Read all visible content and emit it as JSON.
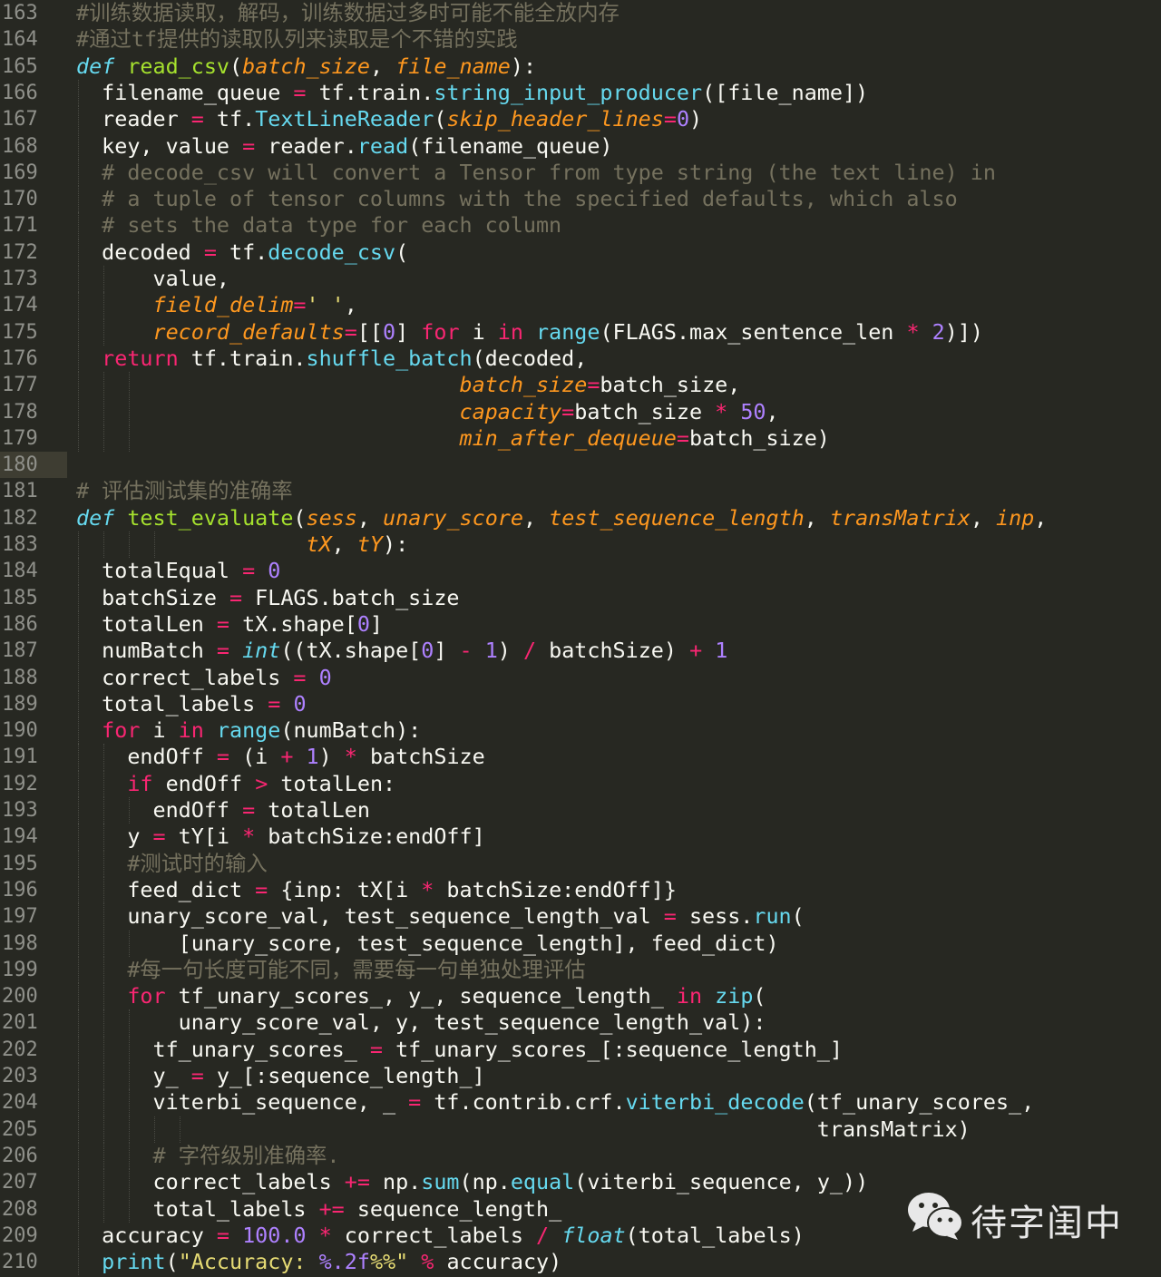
{
  "watermark": {
    "text": "待字闺中",
    "icon": "wechat-icon"
  },
  "highlight_line": 180,
  "colors": {
    "background": "#272822",
    "gutter_text": "#8f908a",
    "comment": "#75715e",
    "keyword": "#f92672",
    "function": "#a6e22e",
    "parameter": "#fd971f",
    "builtin": "#66d9ef",
    "number": "#ae81ff",
    "string": "#e6db74"
  },
  "lines": [
    {
      "n": "163",
      "i": 0,
      "t": [
        [
          "cm",
          "#训练数据读取，解码，训练数据过多时可能不能全放内存"
        ]
      ]
    },
    {
      "n": "164",
      "i": 0,
      "t": [
        [
          "cm",
          "#通过tf提供的读取队列来读取是个不错的实践"
        ]
      ]
    },
    {
      "n": "165",
      "i": 0,
      "t": [
        [
          "st",
          "def"
        ],
        [
          "df",
          " "
        ],
        [
          "fn",
          "read_csv"
        ],
        [
          "df",
          "("
        ],
        [
          "pa",
          "batch_size"
        ],
        [
          "df",
          ", "
        ],
        [
          "pa",
          "file_name"
        ],
        [
          "df",
          "):"
        ]
      ]
    },
    {
      "n": "166",
      "i": 1,
      "t": [
        [
          "df",
          "  filename_queue "
        ],
        [
          "op",
          "="
        ],
        [
          "df",
          " tf.train."
        ],
        [
          "bi",
          "string_input_producer"
        ],
        [
          "df",
          "([file_name])"
        ]
      ]
    },
    {
      "n": "167",
      "i": 1,
      "t": [
        [
          "df",
          "  reader "
        ],
        [
          "op",
          "="
        ],
        [
          "df",
          " tf."
        ],
        [
          "bi",
          "TextLineReader"
        ],
        [
          "df",
          "("
        ],
        [
          "pa",
          "skip_header_lines"
        ],
        [
          "op",
          "="
        ],
        [
          "nu",
          "0"
        ],
        [
          "df",
          ")"
        ]
      ]
    },
    {
      "n": "168",
      "i": 1,
      "t": [
        [
          "df",
          "  key, value "
        ],
        [
          "op",
          "="
        ],
        [
          "df",
          " reader."
        ],
        [
          "bi",
          "read"
        ],
        [
          "df",
          "(filename_queue)"
        ]
      ]
    },
    {
      "n": "169",
      "i": 1,
      "t": [
        [
          "cm",
          "  # decode_csv will convert a Tensor from type string (the text line) in"
        ]
      ]
    },
    {
      "n": "170",
      "i": 1,
      "t": [
        [
          "cm",
          "  # a tuple of tensor columns with the specified defaults, which also"
        ]
      ]
    },
    {
      "n": "171",
      "i": 1,
      "t": [
        [
          "cm",
          "  # sets the data type for each column"
        ]
      ]
    },
    {
      "n": "172",
      "i": 1,
      "t": [
        [
          "df",
          "  decoded "
        ],
        [
          "op",
          "="
        ],
        [
          "df",
          " tf."
        ],
        [
          "bi",
          "decode_csv"
        ],
        [
          "df",
          "("
        ]
      ]
    },
    {
      "n": "173",
      "i": 2,
      "t": [
        [
          "df",
          "      value,"
        ]
      ]
    },
    {
      "n": "174",
      "i": 2,
      "t": [
        [
          "df",
          "      "
        ],
        [
          "pa",
          "field_delim"
        ],
        [
          "op",
          "="
        ],
        [
          "sr",
          "' '"
        ],
        [
          "df",
          ","
        ]
      ]
    },
    {
      "n": "175",
      "i": 2,
      "t": [
        [
          "df",
          "      "
        ],
        [
          "pa",
          "record_defaults"
        ],
        [
          "op",
          "="
        ],
        [
          "df",
          "[["
        ],
        [
          "nu",
          "0"
        ],
        [
          "df",
          "] "
        ],
        [
          "kw",
          "for"
        ],
        [
          "df",
          " i "
        ],
        [
          "kw",
          "in"
        ],
        [
          "df",
          " "
        ],
        [
          "bi",
          "range"
        ],
        [
          "df",
          "(FLAGS.max_sentence_len "
        ],
        [
          "op",
          "*"
        ],
        [
          "df",
          " "
        ],
        [
          "nu",
          "2"
        ],
        [
          "df",
          ")])"
        ]
      ]
    },
    {
      "n": "176",
      "i": 1,
      "t": [
        [
          "df",
          "  "
        ],
        [
          "kw",
          "return"
        ],
        [
          "df",
          " tf.train."
        ],
        [
          "bi",
          "shuffle_batch"
        ],
        [
          "df",
          "(decoded,"
        ]
      ]
    },
    {
      "n": "177",
      "i": 3,
      "t": [
        [
          "df",
          "                              "
        ],
        [
          "pa",
          "batch_size"
        ],
        [
          "op",
          "="
        ],
        [
          "df",
          "batch_size,"
        ]
      ]
    },
    {
      "n": "178",
      "i": 3,
      "t": [
        [
          "df",
          "                              "
        ],
        [
          "pa",
          "capacity"
        ],
        [
          "op",
          "="
        ],
        [
          "df",
          "batch_size "
        ],
        [
          "op",
          "*"
        ],
        [
          "df",
          " "
        ],
        [
          "nu",
          "50"
        ],
        [
          "df",
          ","
        ]
      ]
    },
    {
      "n": "179",
      "i": 3,
      "t": [
        [
          "df",
          "                              "
        ],
        [
          "pa",
          "min_after_dequeue"
        ],
        [
          "op",
          "="
        ],
        [
          "df",
          "batch_size)"
        ]
      ]
    },
    {
      "n": "180",
      "i": 0,
      "t": []
    },
    {
      "n": "181",
      "i": 0,
      "t": [
        [
          "cm",
          "# 评估测试集的准确率"
        ]
      ]
    },
    {
      "n": "182",
      "i": 0,
      "t": [
        [
          "st",
          "def"
        ],
        [
          "df",
          " "
        ],
        [
          "fn",
          "test_evaluate"
        ],
        [
          "df",
          "("
        ],
        [
          "pa",
          "sess"
        ],
        [
          "df",
          ", "
        ],
        [
          "pa",
          "unary_score"
        ],
        [
          "df",
          ", "
        ],
        [
          "pa",
          "test_sequence_length"
        ],
        [
          "df",
          ", "
        ],
        [
          "pa",
          "transMatrix"
        ],
        [
          "df",
          ", "
        ],
        [
          "pa",
          "inp"
        ],
        [
          "df",
          ","
        ]
      ]
    },
    {
      "n": "183",
      "i": 4,
      "t": [
        [
          "df",
          "                  "
        ],
        [
          "pa",
          "tX"
        ],
        [
          "df",
          ", "
        ],
        [
          "pa",
          "tY"
        ],
        [
          "df",
          "):"
        ]
      ]
    },
    {
      "n": "184",
      "i": 1,
      "t": [
        [
          "df",
          "  totalEqual "
        ],
        [
          "op",
          "="
        ],
        [
          "df",
          " "
        ],
        [
          "nu",
          "0"
        ]
      ]
    },
    {
      "n": "185",
      "i": 1,
      "t": [
        [
          "df",
          "  batchSize "
        ],
        [
          "op",
          "="
        ],
        [
          "df",
          " FLAGS.batch_size"
        ]
      ]
    },
    {
      "n": "186",
      "i": 1,
      "t": [
        [
          "df",
          "  totalLen "
        ],
        [
          "op",
          "="
        ],
        [
          "df",
          " tX.shape["
        ],
        [
          "nu",
          "0"
        ],
        [
          "df",
          "]"
        ]
      ]
    },
    {
      "n": "187",
      "i": 1,
      "t": [
        [
          "df",
          "  numBatch "
        ],
        [
          "op",
          "="
        ],
        [
          "df",
          " "
        ],
        [
          "st",
          "int"
        ],
        [
          "df",
          "((tX.shape["
        ],
        [
          "nu",
          "0"
        ],
        [
          "df",
          "] "
        ],
        [
          "op",
          "-"
        ],
        [
          "df",
          " "
        ],
        [
          "nu",
          "1"
        ],
        [
          "df",
          ") "
        ],
        [
          "op",
          "/"
        ],
        [
          "df",
          " batchSize) "
        ],
        [
          "op",
          "+"
        ],
        [
          "df",
          " "
        ],
        [
          "nu",
          "1"
        ]
      ]
    },
    {
      "n": "188",
      "i": 1,
      "t": [
        [
          "df",
          "  correct_labels "
        ],
        [
          "op",
          "="
        ],
        [
          "df",
          " "
        ],
        [
          "nu",
          "0"
        ]
      ]
    },
    {
      "n": "189",
      "i": 1,
      "t": [
        [
          "df",
          "  total_labels "
        ],
        [
          "op",
          "="
        ],
        [
          "df",
          " "
        ],
        [
          "nu",
          "0"
        ]
      ]
    },
    {
      "n": "190",
      "i": 1,
      "t": [
        [
          "df",
          "  "
        ],
        [
          "kw",
          "for"
        ],
        [
          "df",
          " i "
        ],
        [
          "kw",
          "in"
        ],
        [
          "df",
          " "
        ],
        [
          "bi",
          "range"
        ],
        [
          "df",
          "(numBatch):"
        ]
      ]
    },
    {
      "n": "191",
      "i": 2,
      "t": [
        [
          "df",
          "    endOff "
        ],
        [
          "op",
          "="
        ],
        [
          "df",
          " (i "
        ],
        [
          "op",
          "+"
        ],
        [
          "df",
          " "
        ],
        [
          "nu",
          "1"
        ],
        [
          "df",
          ") "
        ],
        [
          "op",
          "*"
        ],
        [
          "df",
          " batchSize"
        ]
      ]
    },
    {
      "n": "192",
      "i": 2,
      "t": [
        [
          "df",
          "    "
        ],
        [
          "kw",
          "if"
        ],
        [
          "df",
          " endOff "
        ],
        [
          "op",
          ">"
        ],
        [
          "df",
          " totalLen:"
        ]
      ]
    },
    {
      "n": "193",
      "i": 3,
      "t": [
        [
          "df",
          "      endOff "
        ],
        [
          "op",
          "="
        ],
        [
          "df",
          " totalLen"
        ]
      ]
    },
    {
      "n": "194",
      "i": 2,
      "t": [
        [
          "df",
          "    y "
        ],
        [
          "op",
          "="
        ],
        [
          "df",
          " tY[i "
        ],
        [
          "op",
          "*"
        ],
        [
          "df",
          " batchSize:endOff]"
        ]
      ]
    },
    {
      "n": "195",
      "i": 2,
      "t": [
        [
          "cm",
          "    #测试时的输入"
        ]
      ]
    },
    {
      "n": "196",
      "i": 2,
      "t": [
        [
          "df",
          "    feed_dict "
        ],
        [
          "op",
          "="
        ],
        [
          "df",
          " {inp: tX[i "
        ],
        [
          "op",
          "*"
        ],
        [
          "df",
          " batchSize:endOff]}"
        ]
      ]
    },
    {
      "n": "197",
      "i": 2,
      "t": [
        [
          "df",
          "    unary_score_val, test_sequence_length_val "
        ],
        [
          "op",
          "="
        ],
        [
          "df",
          " sess."
        ],
        [
          "bi",
          "run"
        ],
        [
          "df",
          "("
        ]
      ]
    },
    {
      "n": "198",
      "i": 3,
      "t": [
        [
          "df",
          "        [unary_score, test_sequence_length], feed_dict)"
        ]
      ]
    },
    {
      "n": "199",
      "i": 2,
      "t": [
        [
          "cm",
          "    #每一句长度可能不同，需要每一句单独处理评估"
        ]
      ]
    },
    {
      "n": "200",
      "i": 2,
      "t": [
        [
          "df",
          "    "
        ],
        [
          "kw",
          "for"
        ],
        [
          "df",
          " tf_unary_scores_, y_, sequence_length_ "
        ],
        [
          "kw",
          "in"
        ],
        [
          "df",
          " "
        ],
        [
          "bi",
          "zip"
        ],
        [
          "df",
          "("
        ]
      ]
    },
    {
      "n": "201",
      "i": 3,
      "t": [
        [
          "df",
          "        unary_score_val, y, test_sequence_length_val):"
        ]
      ]
    },
    {
      "n": "202",
      "i": 3,
      "t": [
        [
          "df",
          "      tf_unary_scores_ "
        ],
        [
          "op",
          "="
        ],
        [
          "df",
          " tf_unary_scores_[:sequence_length_]"
        ]
      ]
    },
    {
      "n": "203",
      "i": 3,
      "t": [
        [
          "df",
          "      y_ "
        ],
        [
          "op",
          "="
        ],
        [
          "df",
          " y_[:sequence_length_]"
        ]
      ]
    },
    {
      "n": "204",
      "i": 3,
      "t": [
        [
          "df",
          "      viterbi_sequence, _ "
        ],
        [
          "op",
          "="
        ],
        [
          "df",
          " tf.contrib.crf."
        ],
        [
          "bi",
          "viterbi_decode"
        ],
        [
          "df",
          "(tf_unary_scores_,"
        ]
      ]
    },
    {
      "n": "205",
      "i": 5,
      "t": [
        [
          "df",
          "                                                          transMatrix)"
        ]
      ]
    },
    {
      "n": "206",
      "i": 3,
      "t": [
        [
          "cm",
          "      # 字符级别准确率."
        ]
      ]
    },
    {
      "n": "207",
      "i": 3,
      "t": [
        [
          "df",
          "      correct_labels "
        ],
        [
          "op",
          "+="
        ],
        [
          "df",
          " np."
        ],
        [
          "bi",
          "sum"
        ],
        [
          "df",
          "(np."
        ],
        [
          "bi",
          "equal"
        ],
        [
          "df",
          "(viterbi_sequence, y_))"
        ]
      ]
    },
    {
      "n": "208",
      "i": 3,
      "t": [
        [
          "df",
          "      total_labels "
        ],
        [
          "op",
          "+="
        ],
        [
          "df",
          " sequence_length_"
        ]
      ]
    },
    {
      "n": "209",
      "i": 1,
      "t": [
        [
          "df",
          "  accuracy "
        ],
        [
          "op",
          "="
        ],
        [
          "df",
          " "
        ],
        [
          "nu",
          "100.0"
        ],
        [
          "df",
          " "
        ],
        [
          "op",
          "*"
        ],
        [
          "df",
          " correct_labels "
        ],
        [
          "op",
          "/"
        ],
        [
          "df",
          " "
        ],
        [
          "st",
          "float"
        ],
        [
          "df",
          "(total_labels)"
        ]
      ]
    },
    {
      "n": "210",
      "i": 1,
      "t": [
        [
          "df",
          "  "
        ],
        [
          "bi",
          "print"
        ],
        [
          "df",
          "("
        ],
        [
          "sr",
          "\"Accuracy: "
        ],
        [
          "nu",
          "%.2f"
        ],
        [
          "sr",
          "%%\""
        ],
        [
          "df",
          " "
        ],
        [
          "op",
          "%"
        ],
        [
          "df",
          " accuracy)"
        ]
      ]
    }
  ]
}
